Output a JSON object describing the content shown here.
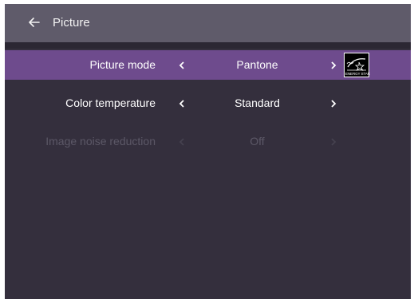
{
  "header": {
    "title": "Picture",
    "back_icon": "arrow-left-icon"
  },
  "settings": [
    {
      "label": "Picture mode",
      "value": "Pantone",
      "selected": true,
      "enabled": true
    },
    {
      "label": "Color temperature",
      "value": "Standard",
      "selected": false,
      "enabled": true
    },
    {
      "label": "Image noise reduction",
      "value": "Off",
      "selected": false,
      "enabled": false
    }
  ],
  "badge": {
    "text": "ENERGY STAR",
    "icon": "energy-star-icon"
  },
  "colors": {
    "background": "#342f3d",
    "header": "#5f5b6a",
    "selected_row": "#6e4b8d",
    "disabled_text": "#5c5867"
  }
}
